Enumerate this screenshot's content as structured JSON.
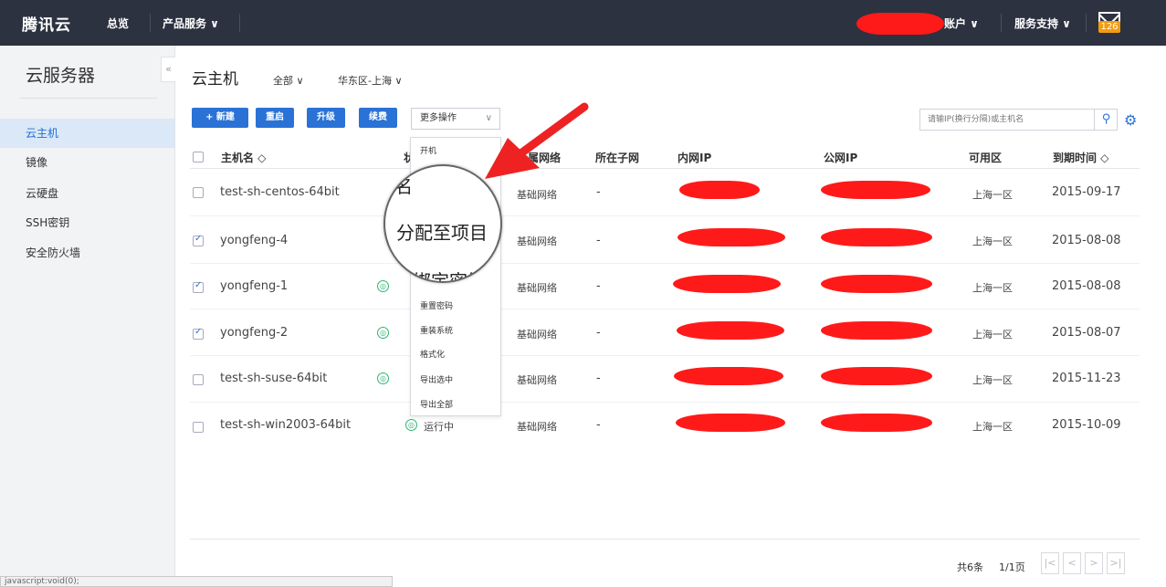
{
  "topbar": {
    "logo": "腾讯云",
    "overview": "总览",
    "products": "产品服务 ∨",
    "account": "账户 ∨",
    "support": "服务支持 ∨",
    "mail_count": "126"
  },
  "sidebar": {
    "title": "云服务器",
    "collapse": "«",
    "items": [
      {
        "label": "云主机",
        "active": true
      },
      {
        "label": "镜像"
      },
      {
        "label": "云硬盘"
      },
      {
        "label": "SSH密钥"
      },
      {
        "label": "安全防火墙"
      }
    ]
  },
  "main": {
    "title": "云主机",
    "filter_all": "全部 ∨",
    "filter_region": "华东区-上海 ∨",
    "buttons": {
      "new": "+ 新建",
      "restart": "重启",
      "upgrade": "升级",
      "renew": "续费",
      "more": "更多操作",
      "more_chev": "∨"
    },
    "search_placeholder": "请输IP(换行分隔)或主机名",
    "search_icon": "⚲",
    "settings_icon": "⚙"
  },
  "table": {
    "headers": {
      "hostname": "主机名 ◇",
      "status": "状",
      "network": "所属网络",
      "subnet": "所在子网",
      "private_ip": "内网IP",
      "public_ip": "公网IP",
      "zone": "可用区",
      "expire": "到期时间 ◇"
    },
    "rows": [
      {
        "name": "test-sh-centos-64bit",
        "checked": false,
        "status": "",
        "network": "基础网络",
        "subnet": "-",
        "zone": "上海一区",
        "expire": "2015-09-17"
      },
      {
        "name": "yongfeng-4",
        "checked": true,
        "status": "",
        "network": "基础网络",
        "subnet": "-",
        "zone": "上海一区",
        "expire": "2015-08-08"
      },
      {
        "name": "yongfeng-1",
        "checked": true,
        "status": "",
        "network": "基础网络",
        "subnet": "-",
        "zone": "上海一区",
        "expire": "2015-08-08"
      },
      {
        "name": "yongfeng-2",
        "checked": true,
        "status": "",
        "network": "基础网络",
        "subnet": "-",
        "zone": "上海一区",
        "expire": "2015-08-07"
      },
      {
        "name": "test-sh-suse-64bit",
        "checked": false,
        "status": "",
        "network": "基础网络",
        "subnet": "-",
        "zone": "上海一区",
        "expire": "2015-11-23"
      },
      {
        "name": "test-sh-win2003-64bit",
        "checked": false,
        "status": "运行中",
        "network": "基础网络",
        "subnet": "-",
        "zone": "上海一区",
        "expire": "2015-10-09"
      }
    ]
  },
  "dropdown": {
    "items": [
      "开机",
      "重置密码",
      "重装系统",
      "格式化",
      "导出选中",
      "导出全部"
    ]
  },
  "magnifier": {
    "lines": [
      "名",
      "分配至项目",
      "绑定密钥"
    ]
  },
  "pager": {
    "total": "共6条",
    "pages": "1/1页",
    "first": "|<",
    "prev": "<",
    "next": ">",
    "last": ">|"
  },
  "statusbar": "javascript:void(0);",
  "colors": {
    "accent": "#2b72d6",
    "topbar": "#2c3240",
    "redaction": "#ff1a1a",
    "arrow": "#ee2222"
  }
}
